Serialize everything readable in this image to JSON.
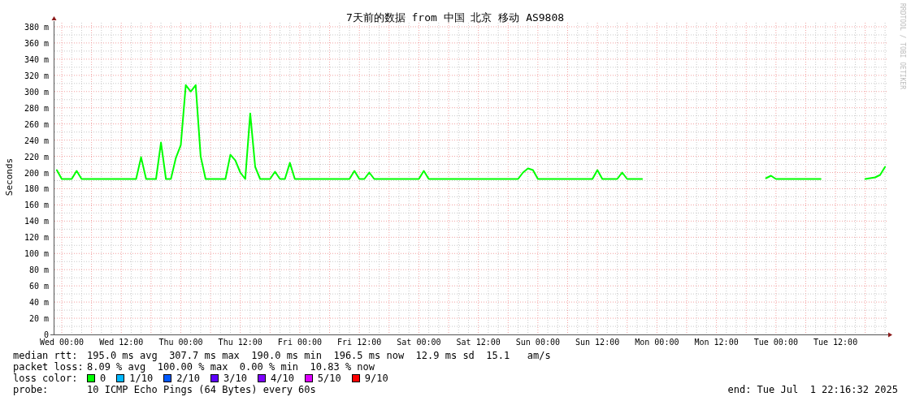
{
  "chart": {
    "chart_data": {
      "type": "line",
      "title": "7天前的数据 from 中国 北京 移动 AS9808",
      "ylabel": "Seconds",
      "grid": true,
      "ylim": [
        0,
        385
      ],
      "categories": [
        null,
        "Wed 00:00",
        null,
        null,
        null,
        null,
        null,
        null,
        null,
        null,
        null,
        null,
        null,
        "Wed 12:00",
        null,
        null,
        null,
        null,
        null,
        null,
        null,
        null,
        null,
        null,
        null,
        "Thu 00:00",
        null,
        null,
        null,
        null,
        null,
        null,
        null,
        null,
        null,
        null,
        null,
        "Thu 12:00",
        null,
        null,
        null,
        null,
        null,
        null,
        null,
        null,
        null,
        null,
        null,
        "Fri 00:00",
        null,
        null,
        null,
        null,
        null,
        null,
        null,
        null,
        null,
        null,
        null,
        "Fri 12:00",
        null,
        null,
        null,
        null,
        null,
        null,
        null,
        null,
        null,
        null,
        null,
        "Sat 00:00",
        null,
        null,
        null,
        null,
        null,
        null,
        null,
        null,
        null,
        null,
        null,
        "Sat 12:00",
        null,
        null,
        null,
        null,
        null,
        null,
        null,
        null,
        null,
        null,
        null,
        "Sun 00:00",
        null,
        null,
        null,
        null,
        null,
        null,
        null,
        null,
        null,
        null,
        null,
        "Sun 12:00",
        null,
        null,
        null,
        null,
        null,
        null,
        null,
        null,
        null,
        null,
        null,
        "Mon 00:00",
        null,
        null,
        null,
        null,
        null,
        null,
        null,
        null,
        null,
        null,
        null,
        "Mon 12:00",
        null,
        null,
        null,
        null,
        null,
        null,
        null,
        null,
        null,
        null,
        null,
        "Tue 00:00",
        null,
        null,
        null,
        null,
        null,
        null,
        null,
        null,
        null,
        null,
        null,
        "Tue 12:00",
        null,
        null,
        null,
        null,
        null,
        null,
        null,
        null,
        null,
        null
      ],
      "yticks": [
        {
          "value": 0,
          "label": "0"
        },
        {
          "value": 20,
          "label": "20 m"
        },
        {
          "value": 40,
          "label": "40 m"
        },
        {
          "value": 60,
          "label": "60 m"
        },
        {
          "value": 80,
          "label": "80 m"
        },
        {
          "value": 100,
          "label": "100 m"
        },
        {
          "value": 120,
          "label": "120 m"
        },
        {
          "value": 140,
          "label": "140 m"
        },
        {
          "value": 160,
          "label": "160 m"
        },
        {
          "value": 180,
          "label": "180 m"
        },
        {
          "value": 200,
          "label": "200 m"
        },
        {
          "value": 220,
          "label": "220 m"
        },
        {
          "value": 240,
          "label": "240 m"
        },
        {
          "value": 260,
          "label": "260 m"
        },
        {
          "value": 280,
          "label": "280 m"
        },
        {
          "value": 300,
          "label": "300 m"
        },
        {
          "value": 320,
          "label": "320 m"
        },
        {
          "value": 340,
          "label": "340 m"
        },
        {
          "value": 360,
          "label": "360 m"
        },
        {
          "value": 380,
          "label": "380 m"
        }
      ],
      "series": [
        {
          "color": "#00ff00",
          "values": [
            203,
            192,
            192,
            192,
            202,
            192,
            192,
            192,
            192,
            192,
            192,
            192,
            192,
            192,
            192,
            192,
            192,
            219,
            192,
            192,
            192,
            237,
            192,
            192,
            218,
            234,
            308,
            300,
            308,
            220,
            192,
            192,
            192,
            192,
            192,
            222,
            215,
            200,
            192,
            273,
            207,
            192,
            192,
            192,
            201,
            192,
            192,
            212,
            192,
            192,
            192,
            192,
            192,
            192,
            192,
            192,
            192,
            192,
            192,
            192,
            202,
            192,
            192,
            200,
            192,
            192,
            192,
            192,
            192,
            192,
            192,
            192,
            192,
            192,
            202,
            192,
            192,
            192,
            192,
            192,
            192,
            192,
            192,
            192,
            192,
            192,
            192,
            192,
            192,
            192,
            192,
            192,
            192,
            192,
            200,
            205,
            203,
            192,
            192,
            192,
            192,
            192,
            192,
            192,
            192,
            192,
            192,
            192,
            192,
            203,
            192,
            192,
            192,
            192,
            200,
            192,
            192,
            192,
            192,
            null,
            null,
            null,
            null,
            null,
            null,
            null,
            null,
            null,
            null,
            null,
            null,
            null,
            null,
            null,
            null,
            null,
            null,
            null,
            null,
            null,
            null,
            null,
            null,
            193,
            196,
            192,
            192,
            192,
            192,
            192,
            192,
            192,
            192,
            192,
            192,
            null,
            null,
            null,
            null,
            null,
            null,
            null,
            null,
            192,
            193,
            194,
            197,
            207
          ]
        }
      ]
    }
  },
  "side_credit": "RRDTOOL / TOBI OETIKER",
  "stats": [
    {
      "label": "median rtt:",
      "text": "195.0 ms avg  307.7 ms max  190.0 ms min  196.5 ms now  12.9 ms sd  15.1   am/s"
    },
    {
      "label": "packet loss:",
      "text": "8.09 % avg  100.00 % max  0.00 % min  10.83 % now"
    }
  ],
  "loss_color": {
    "label": "loss color:",
    "items": [
      {
        "label": "0",
        "color": "#00ff00"
      },
      {
        "label": "1/10",
        "color": "#00b8ff"
      },
      {
        "label": "2/10",
        "color": "#0059ff"
      },
      {
        "label": "3/10",
        "color": "#5e00ff"
      },
      {
        "label": "4/10",
        "color": "#7e00ff"
      },
      {
        "label": "5/10",
        "color": "#dd00ff"
      },
      {
        "label": "9/10",
        "color": "#ff0000"
      }
    ]
  },
  "probe": {
    "label": "probe:",
    "text": "10 ICMP Echo Pings (64 Bytes) every 60s"
  },
  "end": "end: Tue Jul  1 22:16:32 2025"
}
